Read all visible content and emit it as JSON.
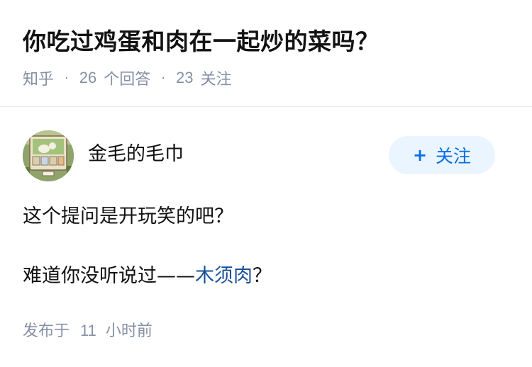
{
  "question": {
    "title": "你吃过鸡蛋和肉在一起炒的菜吗？",
    "site": "知乎",
    "answer_count": "26",
    "answer_label": "个回答",
    "follow_count": "23",
    "follow_label": "关注"
  },
  "answer": {
    "author": {
      "name": "金毛的毛巾",
      "avatar_icon": "game-scene-avatar"
    },
    "follow_button": {
      "plus": "+",
      "label": "关注"
    },
    "content": {
      "line1": "这个提问是开玩笑的吧？",
      "line2_prefix": "难道你没听说过——",
      "line2_link": "木须肉",
      "line2_suffix": "？"
    },
    "published": {
      "prefix": "发布于",
      "count": "11",
      "unit": "小时前"
    }
  },
  "colors": {
    "accent": "#056de8",
    "link": "#175199",
    "meta": "#8590a6",
    "follow_bg": "#ebf5ff"
  }
}
